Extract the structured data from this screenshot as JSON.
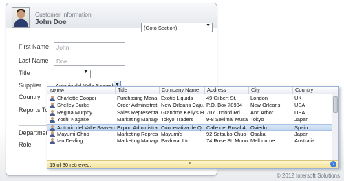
{
  "header": {
    "subtitle": "Customer Information",
    "name": "John Doe",
    "goto_value": "(Goto Section)"
  },
  "form": {
    "first_name_label": "First Name",
    "first_name_value": "John",
    "last_name_label": "Last Name",
    "last_name_value": "Doe",
    "title_label": "Title",
    "title_value": "",
    "supplier_label": "Supplier",
    "supplier_value": "Antonio del Valle Saavedra",
    "country_label": "Country",
    "reports_to_label": "Reports To",
    "department_label": "Department",
    "role_label": "Role"
  },
  "grid": {
    "columns": [
      "Name",
      "Title",
      "Company Name",
      "Address",
      "City",
      "Country"
    ],
    "rows": [
      [
        "Charlotte Cooper",
        "Purchasing Mana...",
        "Exotic Liquids",
        "49 Gilbert St.",
        "London",
        "UK"
      ],
      [
        "Shelley Burke",
        "Order Administrat...",
        "New Orleans Caju...",
        "P.O. Box 78934",
        "New Orleans",
        "USA"
      ],
      [
        "Regina Murphy",
        "Sales Representa...",
        "Grandma Kelly's H...",
        "707 Oxford Rd.",
        "Ann Arbor",
        "USA"
      ],
      [
        "Yoshi Nagase",
        "Marketing Manager",
        "Tokyo Traders",
        "9-8 Sekimai Musas...",
        "Tokyo",
        "Japan"
      ],
      [
        "Antonio del Valle Saavedra",
        "Export Administra...",
        "Cooperativa de Q...",
        "Calle del Rosal 4",
        "Oviedo",
        "Spain"
      ],
      [
        "Mayumi Ohno",
        "Marketing Repres...",
        "Mayumi's",
        "92 Setsuko Chuo-...",
        "Osaka",
        "Japan"
      ],
      [
        "Ian Devling",
        "Marketing Manager",
        "Pavlova, Ltd.",
        "74 Rose St. Moon...",
        "Melbourne",
        "Australia"
      ]
    ],
    "selected_row": 4,
    "footer_text": "15 of 30 retrieved.",
    "footer_chevron": "»",
    "help_glyph": "?"
  },
  "copyright": "© 2012 Intersoft Solutions"
}
